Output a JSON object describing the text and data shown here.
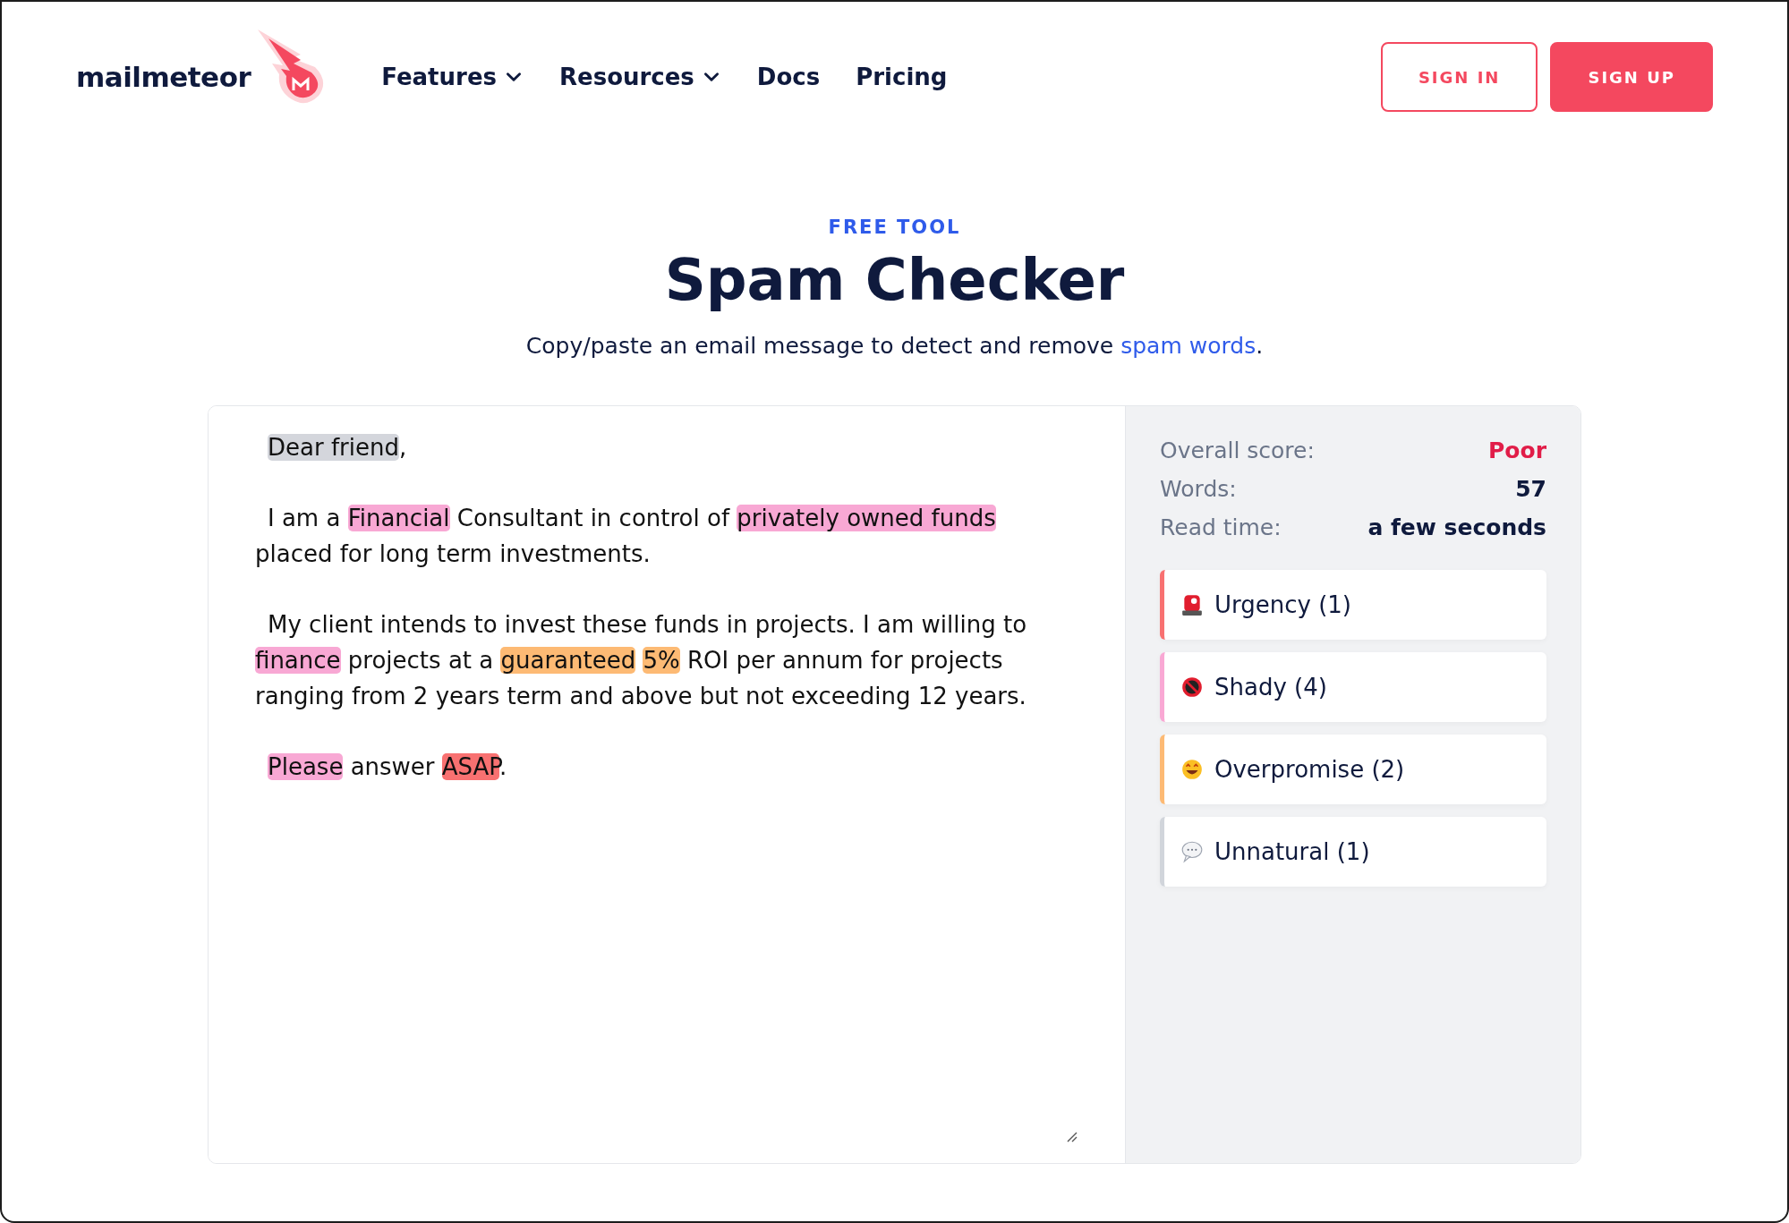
{
  "header": {
    "logo": "mailmeteor",
    "nav": [
      {
        "label": "Features",
        "dropdown": true
      },
      {
        "label": "Resources",
        "dropdown": true
      },
      {
        "label": "Docs",
        "dropdown": false
      },
      {
        "label": "Pricing",
        "dropdown": false
      }
    ],
    "buttons": [
      {
        "label": "SIGN IN",
        "kind": "outline"
      },
      {
        "label": "SIGN UP",
        "kind": "solid"
      }
    ]
  },
  "hero": {
    "eyebrow": "FREE TOOL",
    "title": "Spam Checker",
    "subtitle": "Copy/paste an email message to detect and remove ",
    "subtitle_link": "spam words",
    "subtitle_end": "."
  },
  "editor": {
    "paragraphs": [
      [
        {
          "text": "Dear friend",
          "color": "#d4d6dc"
        },
        {
          "text": ","
        }
      ],
      [
        {
          "text": "I am a "
        },
        {
          "text": "Financial",
          "color": "#f8a8d4"
        },
        {
          "text": " Consultant in control of "
        },
        {
          "text": "privately owned funds",
          "color": "#f8a8d4"
        },
        {
          "text": " placed for long term investments."
        }
      ],
      [
        {
          "text": "My client intends to invest these funds in projects. I am willing to "
        },
        {
          "text": "finance",
          "color": "#f8a8d4"
        },
        {
          "text": " projects at a "
        },
        {
          "text": "guaranteed",
          "color": "#fdba74",
          "space_after": true
        },
        {
          "text": "5%",
          "color": "#fdba74"
        },
        {
          "text": " ROI per annum for projects ranging from 2 years term and above but not exceeding 12 years."
        }
      ],
      [
        {
          "text": "Please",
          "color": "#f8a8d4"
        },
        {
          "text": " answer "
        },
        {
          "text": "ASAP",
          "color": "#f87171"
        },
        {
          "text": "."
        }
      ]
    ]
  },
  "stats": [
    {
      "label": "Overall score:",
      "value": "Poor",
      "kind": "score"
    },
    {
      "label": "Words:",
      "value": "57",
      "kind": "plain"
    },
    {
      "label": "Read time:",
      "value": "a few seconds",
      "kind": "plain"
    }
  ],
  "categories": [
    {
      "label": "Urgency (1)",
      "color": "#f87171",
      "kind": "siren"
    },
    {
      "label": "Shady (4)",
      "color": "#f9a8d4",
      "kind": "prohibited"
    },
    {
      "label": "Overpromise (2)",
      "color": "#fdba74",
      "kind": "face"
    },
    {
      "label": "Unnatural (1)",
      "color": "#d1d5db",
      "kind": "bubble"
    }
  ]
}
